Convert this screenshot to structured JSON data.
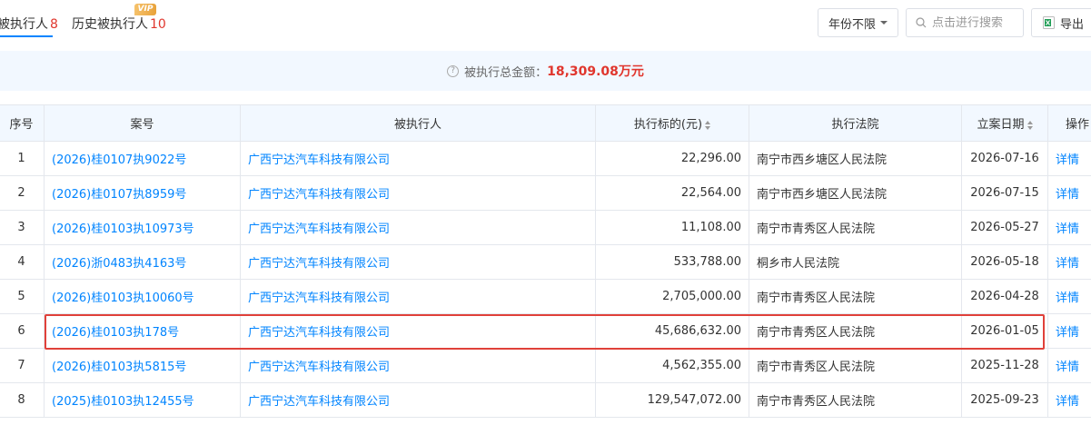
{
  "tabs": [
    {
      "label": "被执行人",
      "count": "8"
    },
    {
      "label": "历史被执行人",
      "count": "10",
      "badge": "VIP"
    }
  ],
  "toolbar": {
    "year_filter": "年份不限",
    "search_placeholder": "点击进行搜索",
    "export_label": "导出"
  },
  "summary": {
    "label": "被执行总金额：",
    "amount": "18,309.08万元"
  },
  "table": {
    "headers": {
      "seq": "序号",
      "case_no": "案号",
      "executed": "被执行人",
      "amount": "执行标的(元)",
      "court": "执行法院",
      "date": "立案日期",
      "action": "操作"
    },
    "rows": [
      {
        "seq": "1",
        "case_no": "(2026)桂0107执9022号",
        "executed": "广西宁达汽车科技有限公司",
        "amount": "22,296.00",
        "court": "南宁市西乡塘区人民法院",
        "date": "2026-07-16",
        "action": "详情"
      },
      {
        "seq": "2",
        "case_no": "(2026)桂0107执8959号",
        "executed": "广西宁达汽车科技有限公司",
        "amount": "22,564.00",
        "court": "南宁市西乡塘区人民法院",
        "date": "2026-07-15",
        "action": "详情"
      },
      {
        "seq": "3",
        "case_no": "(2026)桂0103执10973号",
        "executed": "广西宁达汽车科技有限公司",
        "amount": "11,108.00",
        "court": "南宁市青秀区人民法院",
        "date": "2026-05-27",
        "action": "详情"
      },
      {
        "seq": "4",
        "case_no": "(2026)浙0483执4163号",
        "executed": "广西宁达汽车科技有限公司",
        "amount": "533,788.00",
        "court": "桐乡市人民法院",
        "date": "2026-05-18",
        "action": "详情"
      },
      {
        "seq": "5",
        "case_no": "(2026)桂0103执10060号",
        "executed": "广西宁达汽车科技有限公司",
        "amount": "2,705,000.00",
        "court": "南宁市青秀区人民法院",
        "date": "2026-04-28",
        "action": "详情"
      },
      {
        "seq": "6",
        "case_no": "(2026)桂0103执178号",
        "executed": "广西宁达汽车科技有限公司",
        "amount": "45,686,632.00",
        "court": "南宁市青秀区人民法院",
        "date": "2026-01-05",
        "action": "详情"
      },
      {
        "seq": "7",
        "case_no": "(2026)桂0103执5815号",
        "executed": "广西宁达汽车科技有限公司",
        "amount": "4,562,355.00",
        "court": "南宁市青秀区人民法院",
        "date": "2025-11-28",
        "action": "详情"
      },
      {
        "seq": "8",
        "case_no": "(2025)桂0103执12455号",
        "executed": "广西宁达汽车科技有限公司",
        "amount": "129,547,072.00",
        "court": "南宁市青秀区人民法院",
        "date": "2025-09-23",
        "action": "详情"
      }
    ]
  },
  "colors": {
    "accent": "#0084ff",
    "count_red": "#e0362d",
    "highlight_border": "#e0413a",
    "header_bg": "#f2f8ff"
  }
}
